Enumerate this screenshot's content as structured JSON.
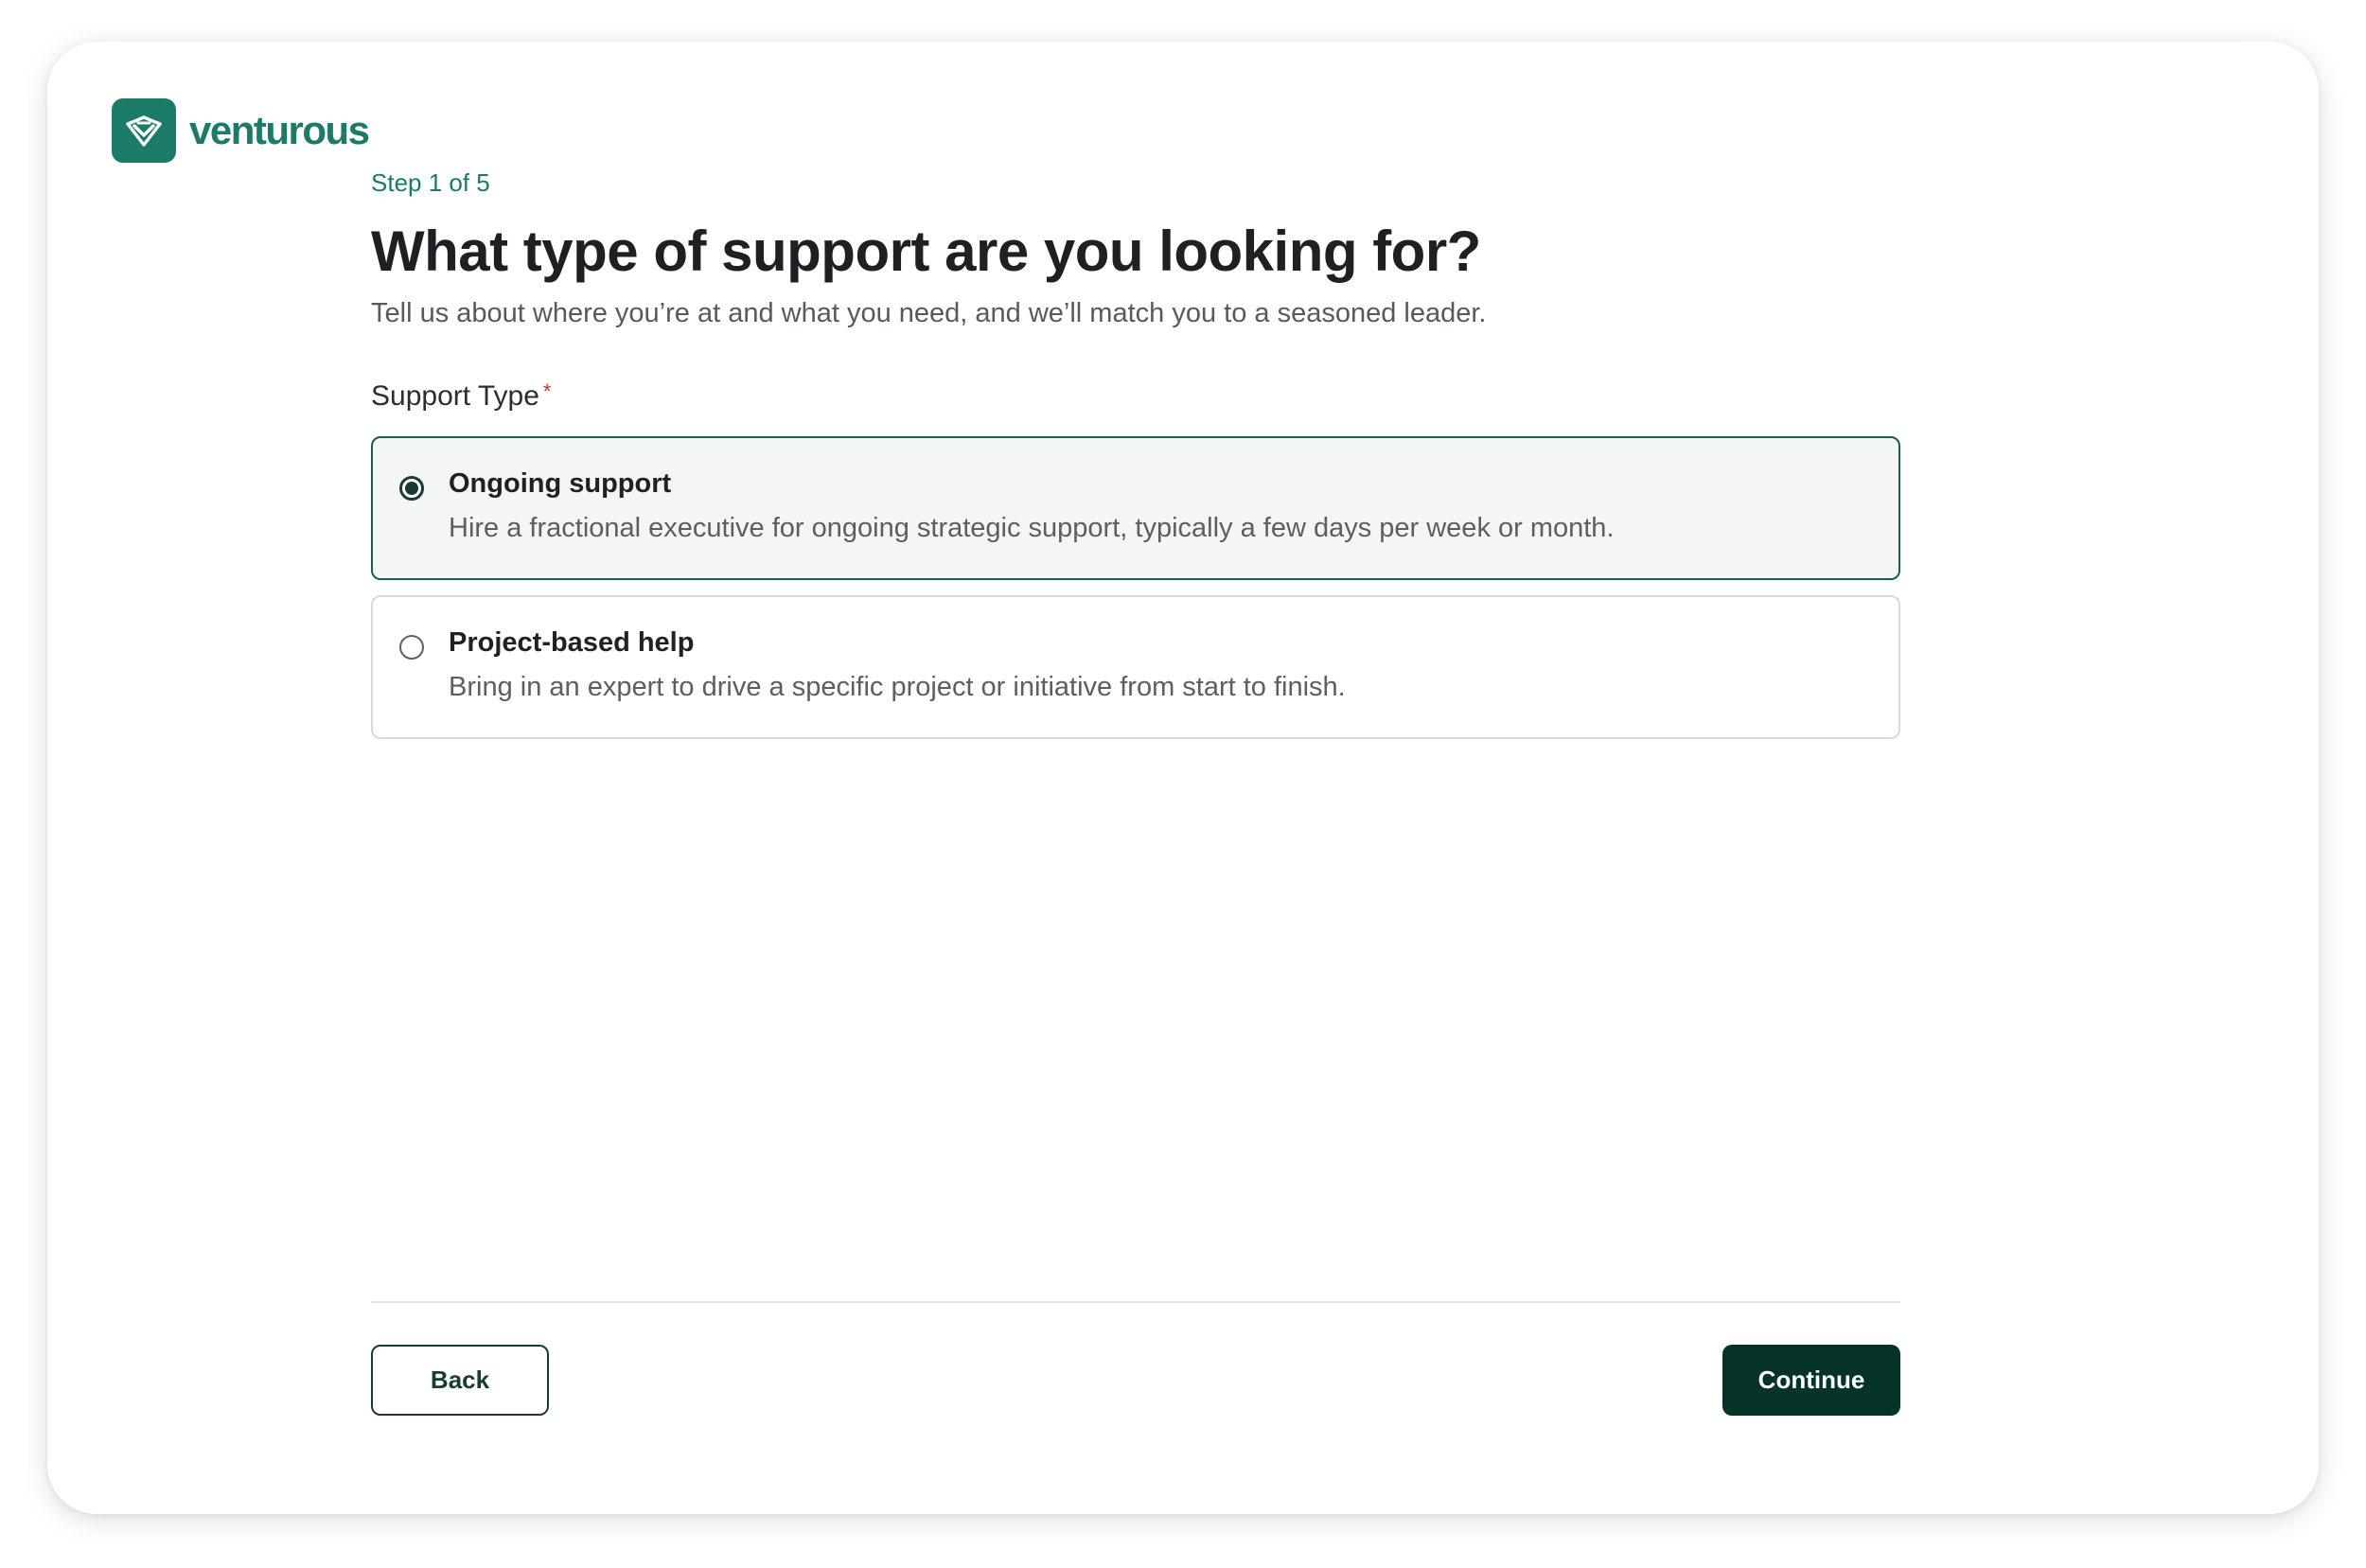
{
  "brand": {
    "name": "venturous",
    "color": "#1c7a69"
  },
  "step": {
    "text": "Step 1 of 5"
  },
  "heading": {
    "title": "What type of support are you looking for?",
    "subtitle": "Tell us about where you’re at and what you need, and we’ll match you to a seasoned leader."
  },
  "field": {
    "label": "Support Type",
    "required_mark": "*",
    "selected_value": "Ongoing support",
    "options": [
      {
        "title": "Ongoing support",
        "description": "Hire a fractional executive for ongoing strategic support, typically a few days per week or month.",
        "selected": true
      },
      {
        "title": "Project-based help",
        "description": "Bring in an expert to drive a specific project or initiative from start to finish.",
        "selected": false
      }
    ]
  },
  "footer": {
    "back_label": "Back",
    "continue_label": "Continue"
  },
  "colors": {
    "accent": "#1c7a69",
    "selected_border": "#1b5e4f",
    "primary_button": "#053229",
    "required": "#d42c35"
  }
}
